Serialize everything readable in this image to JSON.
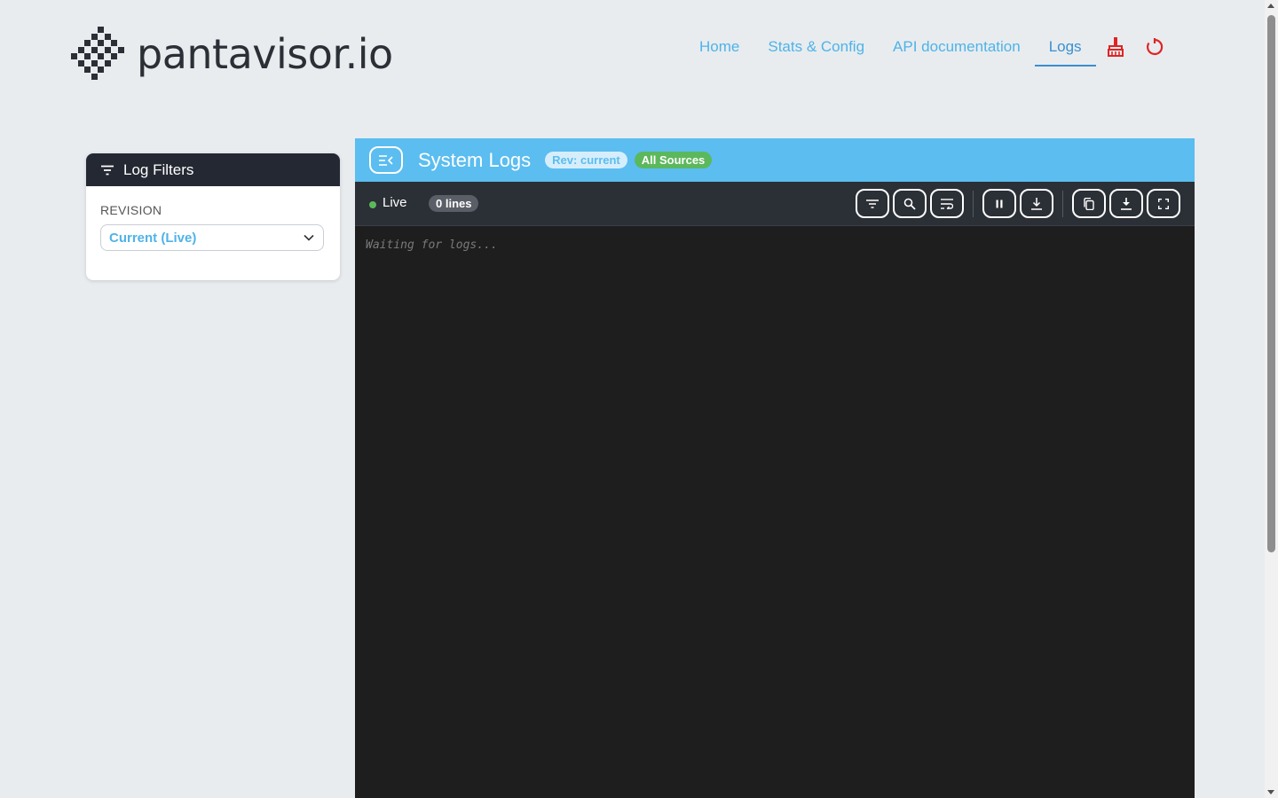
{
  "brand": {
    "name": "pantavisor.io"
  },
  "nav": {
    "items": [
      "Home",
      "Stats & Config",
      "API documentation",
      "Logs"
    ],
    "active": "Logs",
    "icons": [
      "broom-icon",
      "power-icon"
    ],
    "icon_color": "#e02424"
  },
  "filters": {
    "title": "Log Filters",
    "revision_label": "REVISION",
    "revision_value": "Current (Live)"
  },
  "logs": {
    "title": "System Logs",
    "rev_badge": "Rev: current",
    "source_badge": "All Sources",
    "live_label": "Live",
    "lines_count": "0 lines",
    "placeholder": "Waiting for logs...",
    "toolbar_icons": [
      "filter-icon",
      "search-icon",
      "wrap-icon",
      "pause-icon",
      "scroll-bottom-icon",
      "copy-icon",
      "download-icon",
      "fullscreen-icon"
    ]
  },
  "colors": {
    "accent": "#4fb3e8",
    "header_bg": "#5bbdf0",
    "dark": "#242833",
    "success": "#5cb85c"
  }
}
